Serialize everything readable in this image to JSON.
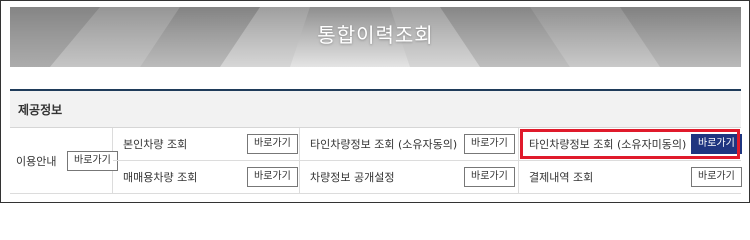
{
  "banner": {
    "title": "통합이력조회"
  },
  "section": {
    "title": "제공정보"
  },
  "usage": {
    "label": "이용안내",
    "button": "바로가기"
  },
  "services": [
    {
      "label": "본인차량 조회",
      "button": "바로가기"
    },
    {
      "label": "타인차량정보 조회 (소유자동의)",
      "button": "바로가기"
    },
    {
      "label": "타인차량정보 조회 (소유자미동의)",
      "button": "바로가기"
    },
    {
      "label": "매매용차량 조회",
      "button": "바로가기"
    },
    {
      "label": "차량정보 공개설정",
      "button": "바로가기"
    },
    {
      "label": "결제내역 조회",
      "button": "바로가기"
    }
  ],
  "colors": {
    "header_rule": "#1f3b5a",
    "highlight": "#e01a2b",
    "primary_button": "#1f3580"
  }
}
